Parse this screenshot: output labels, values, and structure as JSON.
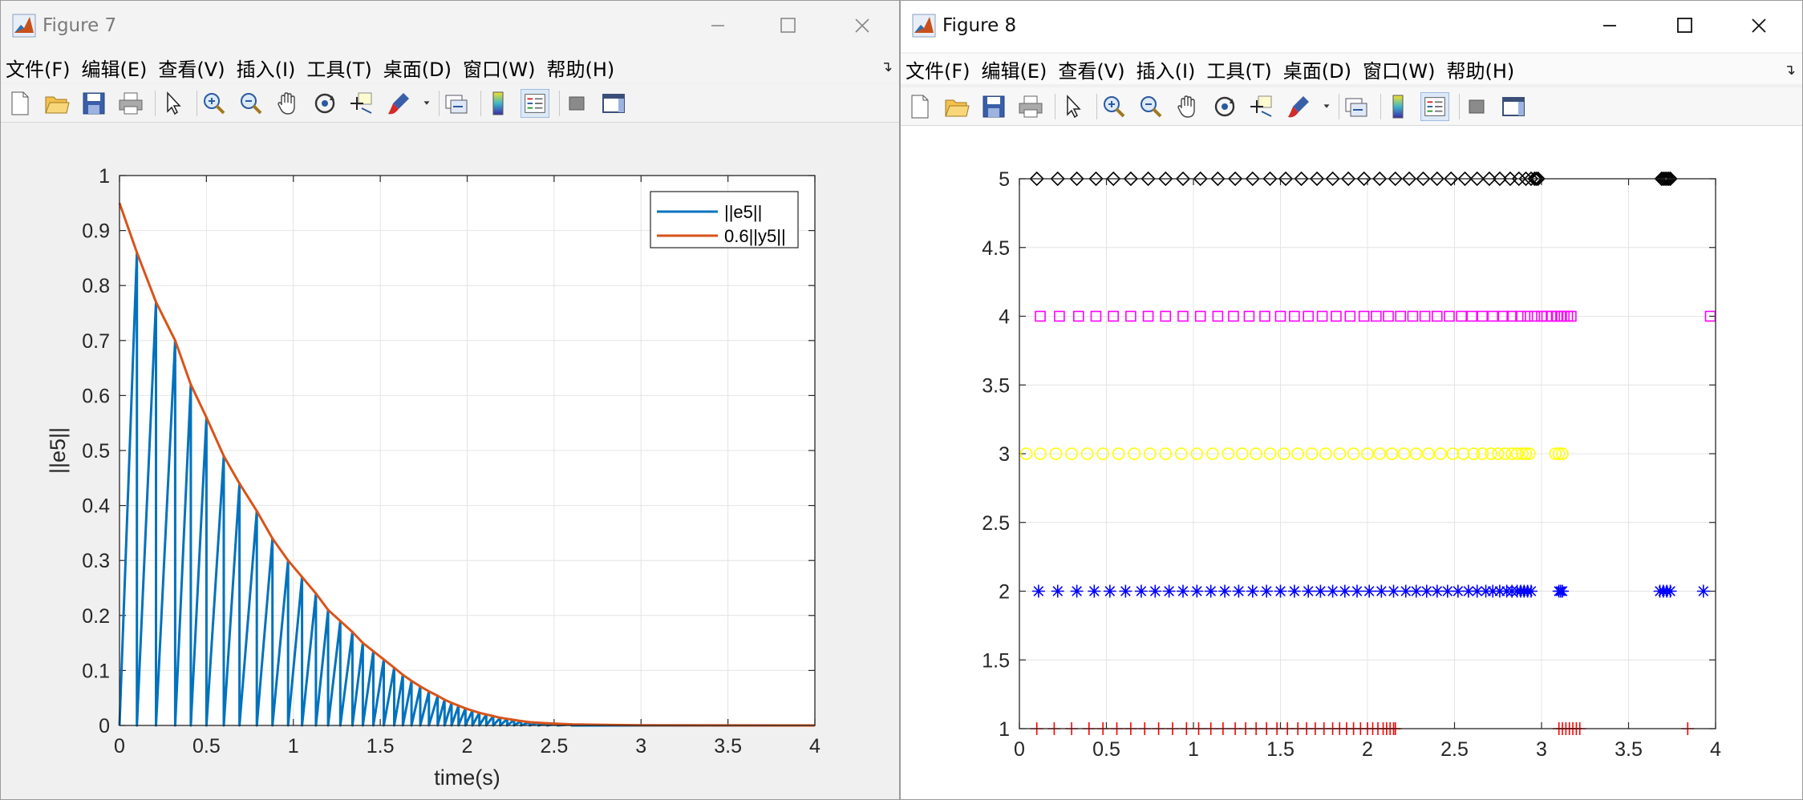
{
  "figure7": {
    "title": "Figure 7",
    "menu": [
      "文件(F)",
      "编辑(E)",
      "查看(V)",
      "插入(I)",
      "工具(T)",
      "桌面(D)",
      "窗口(W)",
      "帮助(H)"
    ],
    "chart_data": {
      "type": "line",
      "xlabel": "time(s)",
      "ylabel": "||e5||",
      "xlim": [
        0,
        4
      ],
      "ylim": [
        0,
        1
      ],
      "xticks": [
        "0",
        "0.5",
        "1",
        "1.5",
        "2",
        "2.5",
        "3",
        "3.5",
        "4"
      ],
      "yticks": [
        "0",
        "0.1",
        "0.2",
        "0.3",
        "0.4",
        "0.5",
        "0.6",
        "0.7",
        "0.8",
        "0.9",
        "1"
      ],
      "grid": true,
      "legend_position": "top-right",
      "series": [
        {
          "name": "||e5||",
          "color": "#0072BD",
          "points": [
            [
              0,
              0
            ],
            [
              0.1,
              0.86
            ],
            [
              0.1,
              0
            ],
            [
              0.21,
              0.77
            ],
            [
              0.21,
              0
            ],
            [
              0.32,
              0.7
            ],
            [
              0.32,
              0
            ],
            [
              0.41,
              0.62
            ],
            [
              0.41,
              0
            ],
            [
              0.5,
              0.56
            ],
            [
              0.5,
              0
            ],
            [
              0.6,
              0.49
            ],
            [
              0.6,
              0
            ],
            [
              0.69,
              0.44
            ],
            [
              0.69,
              0
            ],
            [
              0.79,
              0.39
            ],
            [
              0.79,
              0
            ],
            [
              0.88,
              0.34
            ],
            [
              0.88,
              0
            ],
            [
              0.97,
              0.3
            ],
            [
              0.97,
              0
            ],
            [
              1.05,
              0.27
            ],
            [
              1.05,
              0
            ],
            [
              1.13,
              0.24
            ],
            [
              1.13,
              0
            ],
            [
              1.2,
              0.21
            ],
            [
              1.2,
              0
            ],
            [
              1.27,
              0.19
            ],
            [
              1.27,
              0
            ],
            [
              1.34,
              0.17
            ],
            [
              1.34,
              0
            ],
            [
              1.4,
              0.15
            ],
            [
              1.4,
              0
            ],
            [
              1.46,
              0.135
            ],
            [
              1.46,
              0
            ],
            [
              1.52,
              0.12
            ],
            [
              1.52,
              0
            ],
            [
              1.58,
              0.105
            ],
            [
              1.58,
              0
            ],
            [
              1.63,
              0.092
            ],
            [
              1.63,
              0
            ],
            [
              1.68,
              0.081
            ],
            [
              1.68,
              0
            ],
            [
              1.73,
              0.071
            ],
            [
              1.73,
              0
            ],
            [
              1.78,
              0.062
            ],
            [
              1.78,
              0
            ],
            [
              1.83,
              0.054
            ],
            [
              1.83,
              0
            ],
            [
              1.87,
              0.047
            ],
            [
              1.87,
              0
            ],
            [
              1.91,
              0.041
            ],
            [
              1.91,
              0
            ],
            [
              1.95,
              0.036
            ],
            [
              1.95,
              0
            ],
            [
              1.99,
              0.031
            ],
            [
              1.99,
              0
            ],
            [
              2.03,
              0.027
            ],
            [
              2.03,
              0
            ],
            [
              2.07,
              0.023
            ],
            [
              2.07,
              0
            ],
            [
              2.11,
              0.02
            ],
            [
              2.11,
              0
            ],
            [
              2.15,
              0.017
            ],
            [
              2.15,
              0
            ],
            [
              2.19,
              0.014
            ],
            [
              2.19,
              0
            ],
            [
              2.23,
              0.012
            ],
            [
              2.23,
              0
            ],
            [
              2.27,
              0.01
            ],
            [
              2.27,
              0
            ],
            [
              2.31,
              0.008
            ],
            [
              2.31,
              0
            ],
            [
              2.36,
              0.006
            ],
            [
              2.36,
              0
            ],
            [
              2.41,
              0.005
            ],
            [
              2.41,
              0
            ],
            [
              2.46,
              0.004
            ],
            [
              2.46,
              0
            ],
            [
              2.52,
              0.003
            ],
            [
              2.52,
              0
            ],
            [
              2.6,
              0.002
            ],
            [
              2.6,
              0
            ],
            [
              4,
              0
            ]
          ]
        },
        {
          "name": "0.6||y5||",
          "color": "#D95319",
          "points": [
            [
              0,
              0.95
            ],
            [
              0.1,
              0.86
            ],
            [
              0.21,
              0.77
            ],
            [
              0.32,
              0.7
            ],
            [
              0.41,
              0.62
            ],
            [
              0.5,
              0.56
            ],
            [
              0.6,
              0.49
            ],
            [
              0.69,
              0.44
            ],
            [
              0.79,
              0.39
            ],
            [
              0.88,
              0.34
            ],
            [
              0.97,
              0.3
            ],
            [
              1.05,
              0.27
            ],
            [
              1.13,
              0.24
            ],
            [
              1.2,
              0.21
            ],
            [
              1.27,
              0.19
            ],
            [
              1.34,
              0.17
            ],
            [
              1.4,
              0.15
            ],
            [
              1.46,
              0.135
            ],
            [
              1.52,
              0.12
            ],
            [
              1.58,
              0.105
            ],
            [
              1.63,
              0.092
            ],
            [
              1.68,
              0.081
            ],
            [
              1.73,
              0.071
            ],
            [
              1.78,
              0.062
            ],
            [
              1.83,
              0.054
            ],
            [
              1.87,
              0.047
            ],
            [
              1.91,
              0.041
            ],
            [
              1.95,
              0.036
            ],
            [
              1.99,
              0.031
            ],
            [
              2.03,
              0.027
            ],
            [
              2.07,
              0.023
            ],
            [
              2.11,
              0.02
            ],
            [
              2.15,
              0.017
            ],
            [
              2.19,
              0.014
            ],
            [
              2.23,
              0.012
            ],
            [
              2.27,
              0.01
            ],
            [
              2.31,
              0.008
            ],
            [
              2.36,
              0.006
            ],
            [
              2.41,
              0.005
            ],
            [
              2.46,
              0.004
            ],
            [
              2.52,
              0.003
            ],
            [
              2.6,
              0.002
            ],
            [
              2.8,
              0.001
            ],
            [
              3,
              0.0005
            ],
            [
              4,
              0
            ]
          ]
        }
      ]
    }
  },
  "figure8": {
    "title": "Figure 8",
    "menu": [
      "文件(F)",
      "编辑(E)",
      "查看(V)",
      "插入(I)",
      "工具(T)",
      "桌面(D)",
      "窗口(W)",
      "帮助(H)"
    ],
    "chart_data": {
      "type": "scatter",
      "xlabel": "",
      "ylabel": "",
      "xlim": [
        0,
        4
      ],
      "ylim": [
        1,
        5
      ],
      "xticks": [
        "0",
        "0.5",
        "1",
        "1.5",
        "2",
        "2.5",
        "3",
        "3.5",
        "4"
      ],
      "yticks": [
        "1",
        "1.5",
        "2",
        "2.5",
        "3",
        "3.5",
        "4",
        "4.5",
        "5"
      ],
      "grid": true,
      "series": [
        {
          "marker": "plus",
          "color": "#FF0000",
          "y": 1,
          "x": [
            0.1,
            0.2,
            0.3,
            0.4,
            0.48,
            0.56,
            0.64,
            0.72,
            0.8,
            0.88,
            0.96,
            1.03,
            1.1,
            1.17,
            1.24,
            1.3,
            1.36,
            1.42,
            1.48,
            1.54,
            1.6,
            1.65,
            1.7,
            1.75,
            1.8,
            1.84,
            1.88,
            1.92,
            1.96,
            2.0,
            2.03,
            2.06,
            2.09,
            2.11,
            2.13,
            2.15,
            2.16,
            3.1,
            3.12,
            3.14,
            3.16,
            3.18,
            3.2,
            3.22,
            3.84
          ]
        },
        {
          "marker": "asterisk",
          "color": "#0000FF",
          "y": 2,
          "x": [
            0.11,
            0.22,
            0.33,
            0.43,
            0.52,
            0.61,
            0.7,
            0.78,
            0.86,
            0.94,
            1.02,
            1.1,
            1.18,
            1.26,
            1.34,
            1.42,
            1.5,
            1.58,
            1.66,
            1.73,
            1.8,
            1.87,
            1.94,
            2.01,
            2.08,
            2.15,
            2.22,
            2.28,
            2.34,
            2.4,
            2.46,
            2.52,
            2.58,
            2.63,
            2.68,
            2.72,
            2.76,
            2.8,
            2.83,
            2.86,
            2.88,
            2.9,
            2.92,
            2.94,
            3.1,
            3.11,
            3.12,
            3.68,
            3.7,
            3.72,
            3.74,
            3.93
          ]
        },
        {
          "marker": "circle",
          "color": "#FFFF00",
          "y": 3,
          "x": [
            0.04,
            0.12,
            0.21,
            0.3,
            0.39,
            0.48,
            0.57,
            0.66,
            0.75,
            0.84,
            0.93,
            1.02,
            1.11,
            1.2,
            1.28,
            1.36,
            1.44,
            1.52,
            1.6,
            1.68,
            1.76,
            1.84,
            1.92,
            2.0,
            2.07,
            2.14,
            2.21,
            2.28,
            2.35,
            2.42,
            2.49,
            2.55,
            2.61,
            2.66,
            2.71,
            2.75,
            2.79,
            2.83,
            2.86,
            2.89,
            2.91,
            2.93,
            3.08,
            3.1,
            3.12
          ]
        },
        {
          "marker": "square",
          "color": "#FF00FF",
          "y": 4,
          "x": [
            0.12,
            0.23,
            0.34,
            0.44,
            0.54,
            0.64,
            0.74,
            0.84,
            0.94,
            1.04,
            1.14,
            1.23,
            1.32,
            1.41,
            1.5,
            1.58,
            1.66,
            1.74,
            1.82,
            1.9,
            1.98,
            2.05,
            2.12,
            2.19,
            2.26,
            2.33,
            2.4,
            2.47,
            2.54,
            2.6,
            2.66,
            2.72,
            2.78,
            2.83,
            2.88,
            2.92,
            2.96,
            3.0,
            3.03,
            3.06,
            3.09,
            3.11,
            3.13,
            3.15,
            3.17,
            3.97
          ]
        },
        {
          "marker": "diamond",
          "color": "#000000",
          "y": 5,
          "x": [
            0.1,
            0.22,
            0.33,
            0.44,
            0.54,
            0.64,
            0.74,
            0.84,
            0.94,
            1.04,
            1.14,
            1.24,
            1.34,
            1.44,
            1.53,
            1.62,
            1.71,
            1.8,
            1.89,
            1.98,
            2.07,
            2.16,
            2.24,
            2.32,
            2.4,
            2.48,
            2.56,
            2.63,
            2.7,
            2.76,
            2.82,
            2.87,
            2.91,
            2.94,
            2.96,
            2.97,
            2.98,
            3.69,
            3.7,
            3.71,
            3.72,
            3.73,
            3.74
          ]
        }
      ]
    }
  }
}
